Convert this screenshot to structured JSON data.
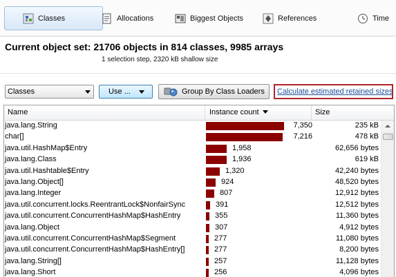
{
  "tabs": [
    {
      "label": "Classes",
      "icon": "classes-icon",
      "active": true
    },
    {
      "label": "Allocations",
      "icon": "allocations-icon",
      "active": false
    },
    {
      "label": "Biggest Objects",
      "icon": "biggest-objects-icon",
      "active": false
    },
    {
      "label": "References",
      "icon": "references-icon",
      "active": false
    },
    {
      "label": "Time",
      "icon": "time-icon",
      "active": false
    }
  ],
  "header": {
    "title": "Current object set:  21706 objects in 814 classes, 9985 arrays",
    "subtitle": "1 selection step, 2320 kB shallow size"
  },
  "toolbar": {
    "view_select": "Classes",
    "use_button": "Use ...",
    "group_button": "Group By Class Loaders",
    "retained_link": "Calculate estimated retained sizes"
  },
  "table": {
    "columns": [
      "Name",
      "Instance count",
      "Size"
    ],
    "sort_column": "Instance count",
    "max_count": 7350,
    "rows": [
      {
        "name": "java.lang.String",
        "count": 7350,
        "count_label": "7,350",
        "size": "235 kB"
      },
      {
        "name": "char[]",
        "count": 7216,
        "count_label": "7,216",
        "size": "478 kB"
      },
      {
        "name": "java.util.HashMap$Entry",
        "count": 1958,
        "count_label": "1,958",
        "size": "62,656 bytes"
      },
      {
        "name": "java.lang.Class",
        "count": 1936,
        "count_label": "1,936",
        "size": "619 kB"
      },
      {
        "name": "java.util.Hashtable$Entry",
        "count": 1320,
        "count_label": "1,320",
        "size": "42,240 bytes"
      },
      {
        "name": "java.lang.Object[]",
        "count": 924,
        "count_label": "924",
        "size": "48,520 bytes"
      },
      {
        "name": "java.lang.Integer",
        "count": 807,
        "count_label": "807",
        "size": "12,912 bytes"
      },
      {
        "name": "java.util.concurrent.locks.ReentrantLock$NonfairSync",
        "count": 391,
        "count_label": "391",
        "size": "12,512 bytes"
      },
      {
        "name": "java.util.concurrent.ConcurrentHashMap$HashEntry",
        "count": 355,
        "count_label": "355",
        "size": "11,360 bytes"
      },
      {
        "name": "java.lang.Object",
        "count": 307,
        "count_label": "307",
        "size": "4,912 bytes"
      },
      {
        "name": "java.util.concurrent.ConcurrentHashMap$Segment",
        "count": 277,
        "count_label": "277",
        "size": "11,080 bytes"
      },
      {
        "name": "java.util.concurrent.ConcurrentHashMap$HashEntry[]",
        "count": 277,
        "count_label": "277",
        "size": "8,200 bytes"
      },
      {
        "name": "java.lang.String[]",
        "count": 257,
        "count_label": "257",
        "size": "11,128 bytes"
      },
      {
        "name": "java.lang.Short",
        "count": 256,
        "count_label": "256",
        "size": "4,096 bytes"
      }
    ]
  },
  "colors": {
    "bar": "#8b0000",
    "link": "#1a4f9a",
    "highlight_border": "#b0222a"
  }
}
